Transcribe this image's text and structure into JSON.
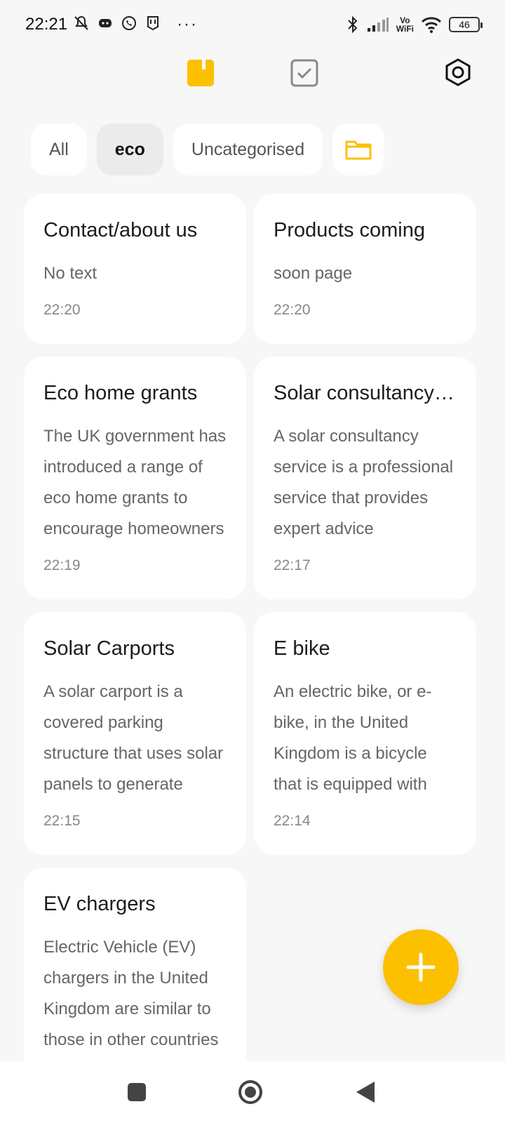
{
  "status_bar": {
    "time": "22:21",
    "more": "···",
    "vowifi_top": "Vo",
    "vowifi_bottom": "WiFi",
    "battery": "46"
  },
  "top_nav": {
    "icons": [
      "notes-icon",
      "tasks-icon",
      "settings-icon"
    ],
    "accent_color": "#fcc000"
  },
  "categories": {
    "chips": [
      "All",
      "eco",
      "Uncategorised"
    ],
    "selected": "eco"
  },
  "notes": [
    {
      "title": "Contact/about us",
      "body": "No text",
      "time": "22:20"
    },
    {
      "title": "Products coming",
      "body": "soon page",
      "time": "22:20"
    },
    {
      "title": "Eco home grants",
      "body": "The UK government has introduced a range of eco home grants to encourage homeowners",
      "time": "22:19"
    },
    {
      "title": "Solar consultancy service",
      "body": "A solar consultancy service is a professional service that provides expert advice",
      "time": "22:17"
    },
    {
      "title": "Solar Carports",
      "body": "A solar carport is a covered parking structure that uses solar panels to generate",
      "time": "22:15"
    },
    {
      "title": "E bike",
      "body": "An electric bike, or e-bike, in the United Kingdom is a bicycle that is equipped with",
      "time": "22:14"
    },
    {
      "title": "EV chargers",
      "body": "Electric Vehicle (EV) chargers in the United Kingdom are similar to those in other countries",
      "time": ""
    }
  ],
  "fab": {
    "icon": "plus-icon"
  },
  "system_nav": {
    "icons": [
      "recents-icon",
      "home-icon",
      "back-icon"
    ]
  }
}
